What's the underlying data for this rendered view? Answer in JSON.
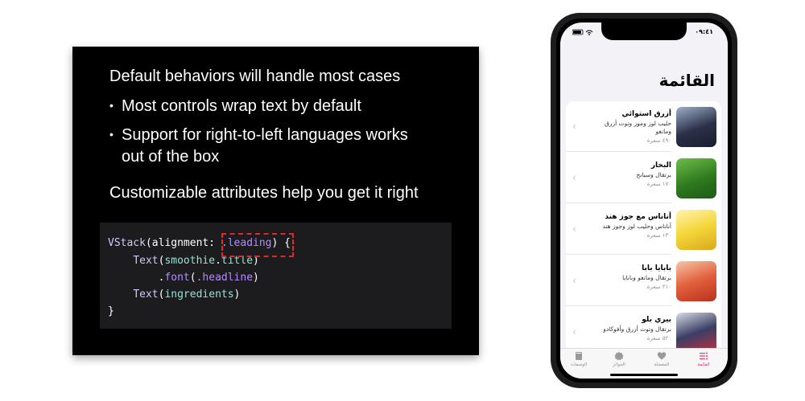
{
  "slide": {
    "heading": "Default behaviors will handle most cases",
    "bullets": [
      "Most controls wrap text by default",
      "Support for right-to-left languages works",
      "out of the box"
    ],
    "subheading": "Customizable attributes help you get it right",
    "code": {
      "line1_type": "VStack",
      "line1_open": "(alignment: ",
      "line1_value": ".leading",
      "line1_close": ") {",
      "line2_type": "Text",
      "line2_open": "(",
      "line2_obj": "smoothie",
      "line2_dot": ".",
      "line2_prop": "title",
      "line2_close": ")",
      "line3_dot": ".",
      "line3_mod": "font",
      "line3_open": "(",
      "line3_arg": ".headline",
      "line3_close": ")",
      "line4_type": "Text",
      "line4_open": "(",
      "line4_arg": "ingredients",
      "line4_close": ")",
      "line5": "}"
    }
  },
  "phone": {
    "status_time": "٠٩:٤١",
    "title": "القائمة",
    "items": [
      {
        "name": "أزرق استوائي",
        "ingredients": "حليب لوز وموز وتوت أزرق ومانغو",
        "calories": "٤٩٠ سعرة",
        "color": "#3a3f5c"
      },
      {
        "name": "البخار",
        "ingredients": "برتقال وسبانخ",
        "calories": "١٧٠ سعرة",
        "color": "#3f8a2c"
      },
      {
        "name": "أناناس مع جوز هند",
        "ingredients": "أناناس وحليب لوز وجوز هند",
        "calories": "١٣٠ سعرة",
        "color": "#f2d23c"
      },
      {
        "name": "بابايا بابا",
        "ingredients": "برتقال ومانغو وبابايا",
        "calories": "٢١٠ سعرة",
        "color": "#e05b3a"
      },
      {
        "name": "بيري بلو",
        "ingredients": "برتقال وتوت أزرق وأفوكادو",
        "calories": "٥٢٠ سعرة",
        "color": "#2c3050"
      }
    ],
    "tabs": [
      {
        "label": "الوصفات",
        "icon": "book-icon"
      },
      {
        "label": "الجوائز",
        "icon": "badge-icon"
      },
      {
        "label": "المفضلة",
        "icon": "heart-icon"
      },
      {
        "label": "القائمة",
        "icon": "list-icon",
        "active": true
      }
    ],
    "accent_color": "#e8336d"
  }
}
